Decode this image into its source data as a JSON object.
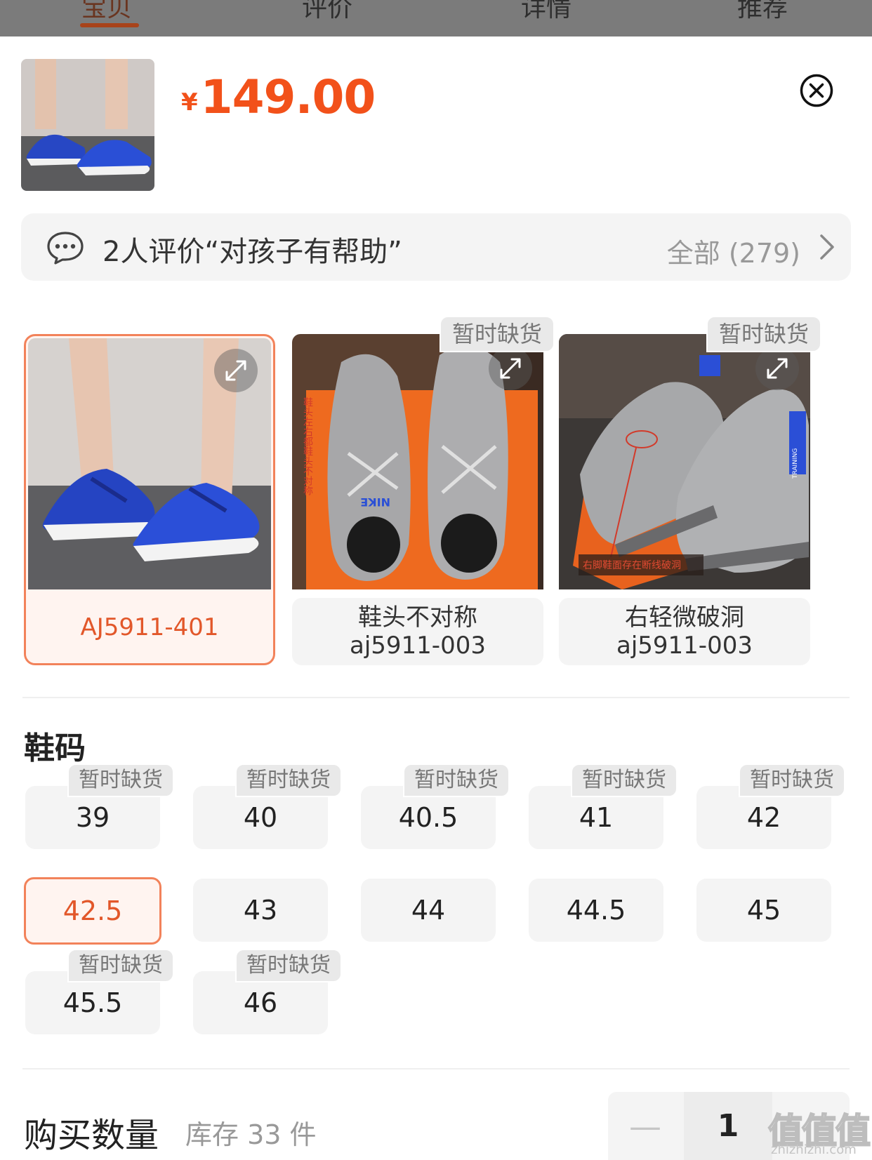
{
  "tabs": [
    {
      "label": "宝贝",
      "active": true
    },
    {
      "label": "评价",
      "active": false
    },
    {
      "label": "详情",
      "active": false
    },
    {
      "label": "推荐",
      "active": false
    }
  ],
  "header": {
    "currency": "¥",
    "price": "149.00",
    "close_icon": "close-circle-icon"
  },
  "review": {
    "icon": "chat-bubble-icon",
    "text": "2人评价“对孩子有帮助”",
    "all_label": "全部 (279)",
    "chevron": "chevron-right-icon"
  },
  "variants": [
    {
      "line1": "AJ5911-401",
      "line2": "",
      "badge": "",
      "selected": true
    },
    {
      "line1": "鞋头不对称",
      "line2": "aj5911-003",
      "badge": "暂时缺货",
      "selected": false
    },
    {
      "line1": "右轻微破洞",
      "line2": "aj5911-003",
      "badge": "暂时缺货",
      "selected": false
    }
  ],
  "photo_captions": {
    "variant2_side": "鞋头左右都鞋头不对称",
    "variant2_box": "NIKE",
    "variant3_bottom": "右脚鞋面存在断线破洞",
    "variant3_side": "TRAINING"
  },
  "size_section": {
    "title": "鞋码",
    "sizes": [
      {
        "label": "39",
        "badge": "暂时缺货",
        "selected": false
      },
      {
        "label": "40",
        "badge": "暂时缺货",
        "selected": false
      },
      {
        "label": "40.5",
        "badge": "暂时缺货",
        "selected": false
      },
      {
        "label": "41",
        "badge": "暂时缺货",
        "selected": false
      },
      {
        "label": "42",
        "badge": "暂时缺货",
        "selected": false
      },
      {
        "label": "42.5",
        "badge": "",
        "selected": true
      },
      {
        "label": "43",
        "badge": "",
        "selected": false
      },
      {
        "label": "44",
        "badge": "",
        "selected": false
      },
      {
        "label": "44.5",
        "badge": "",
        "selected": false
      },
      {
        "label": "45",
        "badge": "",
        "selected": false
      },
      {
        "label": "45.5",
        "badge": "暂时缺货",
        "selected": false
      },
      {
        "label": "46",
        "badge": "暂时缺货",
        "selected": false
      }
    ]
  },
  "quantity": {
    "title": "购买数量",
    "stock": "库存 33 件",
    "minus": "—",
    "value": "1"
  },
  "watermark": {
    "big": "值值值",
    "small": "zhizhizhi.com"
  },
  "colors": {
    "accent": "#f2511a",
    "accent_soft": "#f2825a",
    "selected_bg": "#fff4f0",
    "chip_bg": "#f4f4f4",
    "muted_text": "#999999"
  }
}
